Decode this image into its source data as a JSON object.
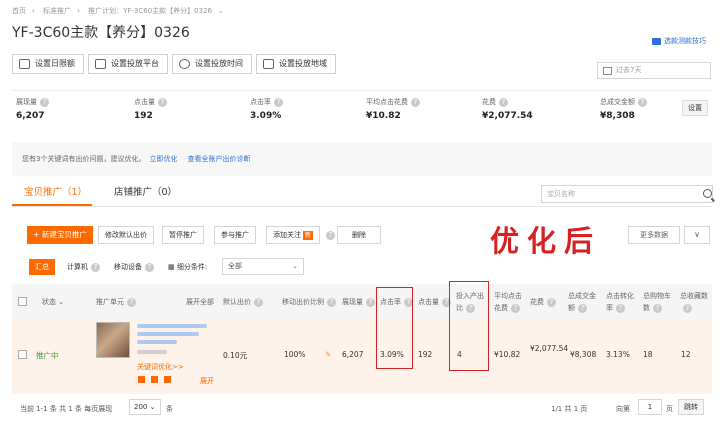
{
  "breadcrumb": [
    "首页",
    "标准推广",
    "推广计划：YF-3C60主款【养分】0326"
  ],
  "page_title": "YF-3C60主款【养分】0326",
  "tip_link": "选款测款技巧",
  "settings": [
    "设置日限额",
    "设置投放平台",
    "设置投放时间",
    "设置投放地域"
  ],
  "date_range": "过去7天",
  "metrics": [
    {
      "label": "展现量",
      "value": "6,207"
    },
    {
      "label": "点击量",
      "value": "192"
    },
    {
      "label": "点击率",
      "value": "3.09%"
    },
    {
      "label": "平均点击花费",
      "value": "¥10.82"
    },
    {
      "label": "花费",
      "value": "¥2,077.54"
    },
    {
      "label": "总成交金额",
      "value": "¥8,308"
    }
  ],
  "metrics_set": "设置",
  "notice": {
    "text": "您有3个关键词有出价问题，建议优化。",
    "link1": "立即优化",
    "link2": "查看全账户出价诊断"
  },
  "tabs": {
    "active": "宝贝推广（1）",
    "inactive": "店铺推广（0）"
  },
  "search_placeholder": "宝贝名称",
  "toolbar": {
    "new": "+ 新建宝贝推广",
    "buttons": [
      "修改默认出价",
      "暂停推广",
      "参与推广",
      "添加关注",
      "删除"
    ],
    "new_badge": "新",
    "more": "更多数据",
    "more_arrow": "∨"
  },
  "annotation": "优化后",
  "filters": {
    "all": "汇总",
    "pc": "计算机",
    "mobile": "移动设备",
    "subdivide": "细分条件:",
    "select": "全部"
  },
  "table": {
    "headers": [
      "状态",
      "推广单元",
      "展开全部",
      "默认出价",
      "移动出价比例",
      "展现量",
      "点击率",
      "点击量",
      "投入产出比",
      "平均点击花费",
      "花费",
      "总成交金额",
      "点击转化率",
      "总购物车数",
      "总收藏数"
    ],
    "row": {
      "status": "推广中",
      "keyword_link": "关键词优化>>",
      "expand": "展开",
      "bid": "0.10元",
      "mobile_ratio": "100%",
      "impressions": "6,207",
      "ctr": "3.09%",
      "clicks": "192",
      "roi": "4",
      "avg_cpc": "¥10.82",
      "cost": "¥2,077.54",
      "total_sales": "¥8,308",
      "conv_rate": "3.13%",
      "cart": "18",
      "fav": "12"
    }
  },
  "footer": {
    "summary": "当前 1-1 条  共 1 条  每页展现",
    "page_size": "200",
    "unit": "条",
    "pages": "1/1  共 1 页",
    "goto": "向第",
    "page_input": "1",
    "page_label": "页",
    "jump": "跳转"
  }
}
